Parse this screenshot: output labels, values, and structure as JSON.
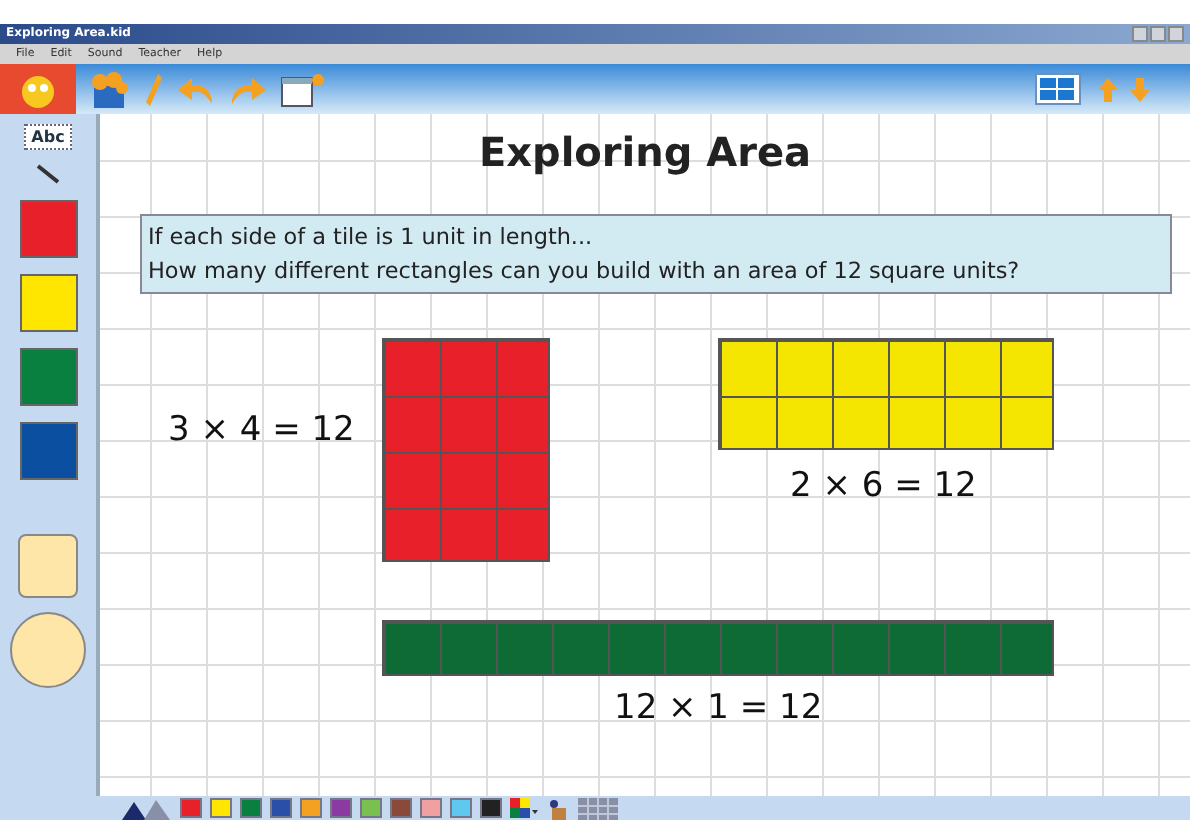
{
  "window": {
    "title": "Exploring Area.kid"
  },
  "menu": [
    "File",
    "Edit",
    "Sound",
    "Teacher",
    "Help"
  ],
  "sidebar": {
    "text_tool": "Abc",
    "colors": [
      {
        "color": "#e8202a"
      },
      {
        "color": "#ffe600"
      },
      {
        "color": "#0a8040"
      },
      {
        "color": "#0a4fa0"
      }
    ]
  },
  "canvas": {
    "title": "Exploring Area",
    "question": [
      "If each side of a tile is 1 unit in length...",
      "How many different rectangles can you build with an area of 12 square units?"
    ],
    "rectangles": [
      {
        "color": "#e8202a",
        "equation": "3 × 4 = 12"
      },
      {
        "color": "#f4e600",
        "equation": "2 × 6 = 12"
      },
      {
        "color": "#0f6b35",
        "equation": "12 × 1 = 12"
      }
    ]
  },
  "palette": [
    {
      "color": "#e8202a"
    },
    {
      "color": "#ffe600"
    },
    {
      "color": "#0a8040"
    },
    {
      "color": "#2a4fa8"
    },
    {
      "color": "#f4a020"
    },
    {
      "color": "#8a3aa0"
    },
    {
      "color": "#7ac050"
    },
    {
      "color": "#8a4a3a"
    },
    {
      "color": "#f0a0a0"
    },
    {
      "color": "#60c8f0"
    },
    {
      "color": "#222222"
    }
  ]
}
